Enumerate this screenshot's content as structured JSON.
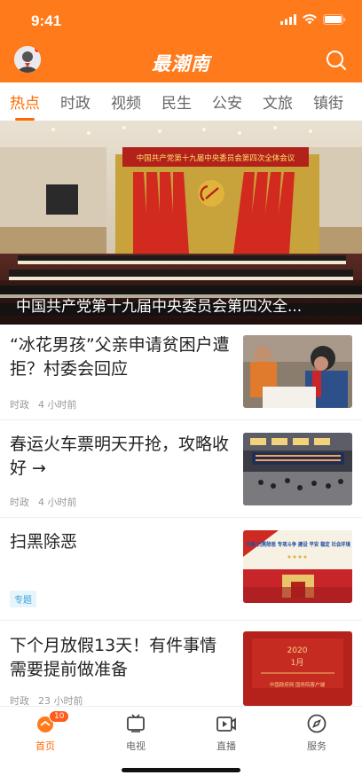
{
  "status": {
    "time": "9:41"
  },
  "header": {
    "title": "最潮南"
  },
  "tabs": [
    {
      "label": "热点",
      "active": true
    },
    {
      "label": "时政"
    },
    {
      "label": "视频"
    },
    {
      "label": "民生"
    },
    {
      "label": "公安"
    },
    {
      "label": "文旅"
    },
    {
      "label": "镇街"
    }
  ],
  "hero": {
    "banner_text": "中国共产党第十九届中央委员会第四次全体会议",
    "caption": "中国共产党第十九届中央委员会第四次全..."
  },
  "news": [
    {
      "title": "“冰花男孩”父亲申请贫困户遭拒？村委会回应",
      "category": "时政",
      "time": "4 小时前"
    },
    {
      "title": "春运火车票明天开抢，攻略收好 →",
      "category": "时政",
      "time": "4 小时前"
    },
    {
      "title": "扫黑除恶",
      "tag": "专题",
      "thumb_text": "开展 扫黑除恶 专项斗争 建设 平安 稳定 社会环境"
    },
    {
      "title": "下个月放假13天！有件事情需要提前做准备",
      "category": "时政",
      "time": "23 小时前",
      "thumb_year": "2020",
      "thumb_month": "1月",
      "thumb_footer": "中国政府网  国务院客户端"
    }
  ],
  "bottom_nav": [
    {
      "label": "首页",
      "icon": "home-icon",
      "badge": "10",
      "active": true
    },
    {
      "label": "电视",
      "icon": "tv-icon"
    },
    {
      "label": "直播",
      "icon": "live-icon"
    },
    {
      "label": "服务",
      "icon": "compass-icon"
    }
  ],
  "colors": {
    "brand": "#ff7a1a",
    "active": "#ff6a00"
  }
}
